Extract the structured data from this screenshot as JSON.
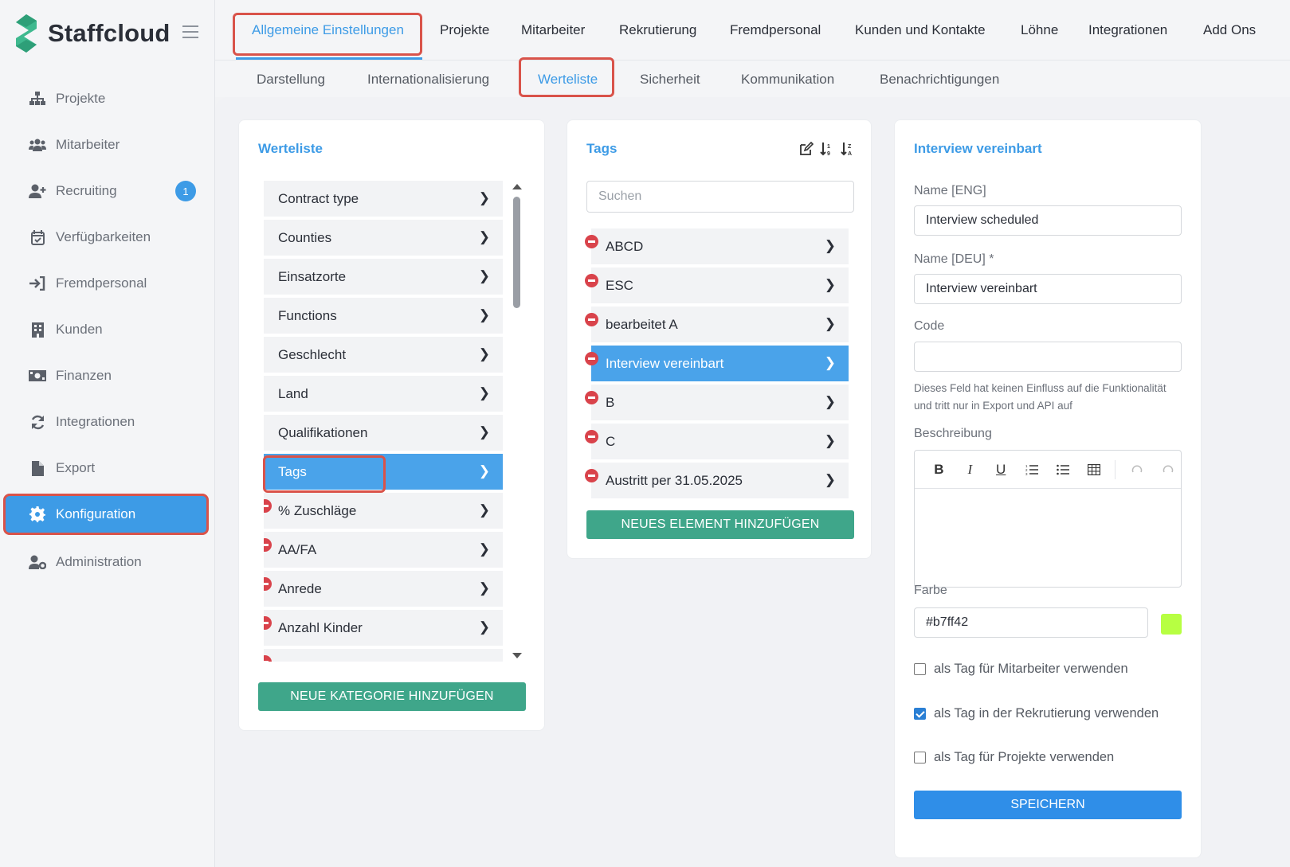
{
  "app": {
    "name": "Staffcloud"
  },
  "sidebar": {
    "items": [
      {
        "label": "Projekte",
        "icon": "sitemap-icon"
      },
      {
        "label": "Mitarbeiter",
        "icon": "users-icon"
      },
      {
        "label": "Recruiting",
        "icon": "user-plus-icon",
        "badge": "1"
      },
      {
        "label": "Verfügbarkeiten",
        "icon": "calendar-check-icon"
      },
      {
        "label": "Fremdpersonal",
        "icon": "sign-in-icon"
      },
      {
        "label": "Kunden",
        "icon": "building-icon"
      },
      {
        "label": "Finanzen",
        "icon": "money-bill-icon"
      },
      {
        "label": "Integrationen",
        "icon": "sync-icon"
      },
      {
        "label": "Export",
        "icon": "file-icon"
      },
      {
        "label": "Konfiguration",
        "icon": "gear-icon",
        "active": true
      },
      {
        "label": "Administration",
        "icon": "user-cog-icon"
      }
    ]
  },
  "topnav": {
    "tabs": [
      {
        "label": "Allgemeine Einstellungen",
        "active": true
      },
      {
        "label": "Projekte"
      },
      {
        "label": "Mitarbeiter"
      },
      {
        "label": "Rekrutierung"
      },
      {
        "label": "Fremdpersonal"
      },
      {
        "label": "Kunden und Kontakte"
      },
      {
        "label": "Löhne"
      },
      {
        "label": "Integrationen"
      },
      {
        "label": "Add Ons"
      }
    ]
  },
  "subnav": {
    "tabs": [
      {
        "label": "Darstellung"
      },
      {
        "label": "Internationalisierung"
      },
      {
        "label": "Werteliste",
        "active": true
      },
      {
        "label": "Sicherheit"
      },
      {
        "label": "Kommunikation"
      },
      {
        "label": "Benachrichtigungen"
      }
    ]
  },
  "werteliste": {
    "title": "Werteliste",
    "items": [
      {
        "label": "Contract type"
      },
      {
        "label": "Counties"
      },
      {
        "label": "Einsatzorte"
      },
      {
        "label": "Functions"
      },
      {
        "label": "Geschlecht"
      },
      {
        "label": "Land"
      },
      {
        "label": "Qualifikationen"
      },
      {
        "label": "Tags",
        "selected": true
      },
      {
        "label": "% Zuschläge",
        "removable": true
      },
      {
        "label": "AA/FA",
        "removable": true
      },
      {
        "label": "Anrede",
        "removable": true
      },
      {
        "label": "Anzahl Kinder",
        "removable": true
      },
      {
        "label": "",
        "removable": true
      }
    ],
    "add_button": "Neue Kategorie hinzufügen"
  },
  "tags": {
    "title": "Tags",
    "search_placeholder": "Suchen",
    "items": [
      {
        "label": "ABCD"
      },
      {
        "label": "ESC"
      },
      {
        "label": "bearbeitet A"
      },
      {
        "label": "Interview vereinbart",
        "selected": true
      },
      {
        "label": "B"
      },
      {
        "label": "C"
      },
      {
        "label": "Austritt per 31.05.2025"
      }
    ],
    "add_button": "Neues Element hinzufügen"
  },
  "detail": {
    "title": "Interview vereinbart",
    "name_eng_label": "Name [ENG]",
    "name_eng_value": "Interview scheduled",
    "name_deu_label": "Name [DEU] *",
    "name_deu_value": "Interview vereinbart",
    "code_label": "Code",
    "code_value": "",
    "code_hint": "Dieses Feld hat keinen Einfluss auf die Funktionalität und tritt nur in Export und API auf",
    "description_label": "Beschreibung",
    "color_label": "Farbe",
    "color_value": "#b7ff42",
    "checkboxes": [
      {
        "label": "als Tag für Mitarbeiter verwenden",
        "checked": false
      },
      {
        "label": "als Tag in der Rekrutierung verwenden",
        "checked": true
      },
      {
        "label": "als Tag für Projekte verwenden",
        "checked": false
      }
    ],
    "save_button": "SPEICHERN"
  },
  "colors": {
    "accent": "#3d9be6",
    "green": "#3fa68a",
    "highlight": "#d9534a",
    "remove": "#d9434b"
  }
}
